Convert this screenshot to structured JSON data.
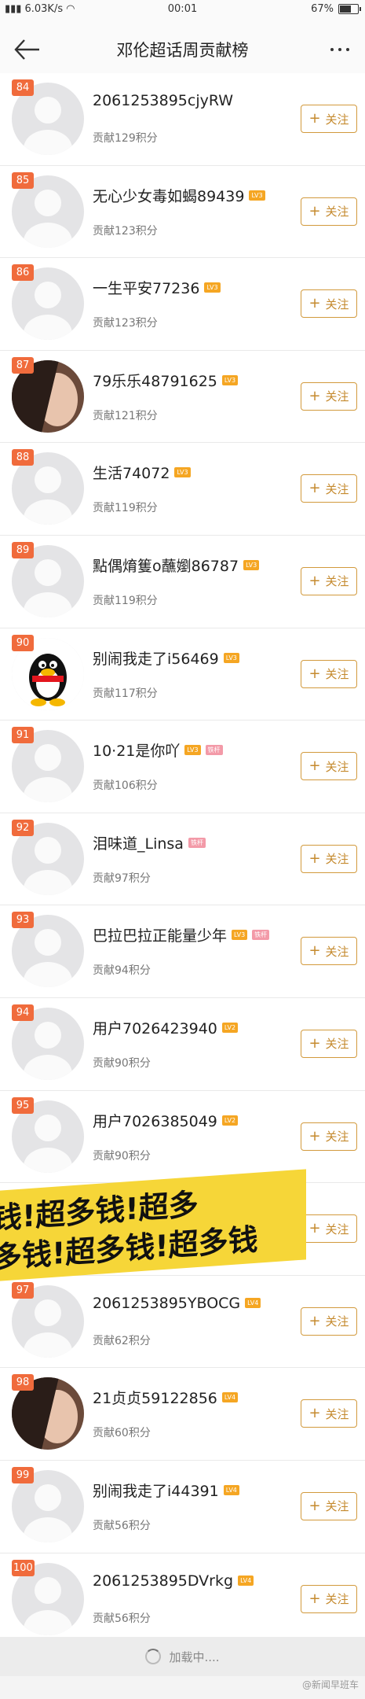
{
  "statusbar": {
    "network": "6.03K/s",
    "time": "00:01",
    "battery": "67%"
  },
  "header": {
    "title": "邓伦超话周贡献榜"
  },
  "follow_label": "关注",
  "rows": [
    {
      "rank": "84",
      "name": "2061253895cjyRW",
      "level": "",
      "fan": "",
      "score": "贡献129积分",
      "avatar": "default"
    },
    {
      "rank": "85",
      "name": "无心少女毒如蝎89439",
      "level": "LV3",
      "fan": "",
      "score": "贡献123积分",
      "avatar": "default"
    },
    {
      "rank": "86",
      "name": "一生平安77236",
      "level": "LV3",
      "fan": "",
      "score": "贡献123积分",
      "avatar": "default"
    },
    {
      "rank": "87",
      "name": "79乐乐48791625",
      "level": "LV3",
      "fan": "",
      "score": "贡献121积分",
      "avatar": "photo"
    },
    {
      "rank": "88",
      "name": "生活74072",
      "level": "LV3",
      "fan": "",
      "score": "贡献119积分",
      "avatar": "default"
    },
    {
      "rank": "89",
      "name": "點偶焴篗o蘸嬼86787",
      "level": "LV3",
      "fan": "",
      "score": "贡献119积分",
      "avatar": "default"
    },
    {
      "rank": "90",
      "name": "别闹我走了i56469",
      "level": "LV3",
      "fan": "",
      "score": "贡献117积分",
      "avatar": "penguin"
    },
    {
      "rank": "91",
      "name": "10·21是你吖",
      "level": "LV3",
      "fan": "铁杆",
      "score": "贡献106积分",
      "avatar": "default"
    },
    {
      "rank": "92",
      "name": "泪味道_Linsa",
      "level": "",
      "fan": "铁杆",
      "score": "贡献97积分",
      "avatar": "default"
    },
    {
      "rank": "93",
      "name": "巴拉巴拉正能量少年",
      "level": "LV3",
      "fan": "铁杆",
      "score": "贡献94积分",
      "avatar": "default"
    },
    {
      "rank": "94",
      "name": "用户7026423940",
      "level": "LV2",
      "fan": "",
      "score": "贡献90积分",
      "avatar": "default"
    },
    {
      "rank": "95",
      "name": "用户7026385049",
      "level": "LV2",
      "fan": "",
      "score": "贡献90积分",
      "avatar": "default"
    },
    {
      "rank": "",
      "name": "",
      "level": "",
      "fan": "",
      "score": "",
      "avatar": "default"
    },
    {
      "rank": "97",
      "name": "2061253895YBOCG",
      "level": "LV4",
      "fan": "",
      "score": "贡献62积分",
      "avatar": "default"
    },
    {
      "rank": "98",
      "name": "21贞贞59122856",
      "level": "LV4",
      "fan": "",
      "score": "贡献60积分",
      "avatar": "photo"
    },
    {
      "rank": "99",
      "name": "别闹我走了i44391",
      "level": "LV4",
      "fan": "",
      "score": "贡献56积分",
      "avatar": "default"
    },
    {
      "rank": "100",
      "name": "2061253895DVrkg",
      "level": "LV4",
      "fan": "",
      "score": "贡献56积分",
      "avatar": "default"
    }
  ],
  "sticker": {
    "line1": "钱!超多钱!超多",
    "line2": "多钱!超多钱!超多钱"
  },
  "loading_text": "加载中....",
  "watermark": "@新闻早班车",
  "colors": {
    "rank_badge": "#f06b3c",
    "follow_border": "#d29a3d",
    "level_badge": "#f5a623",
    "fan_badge": "#f39aa8"
  }
}
